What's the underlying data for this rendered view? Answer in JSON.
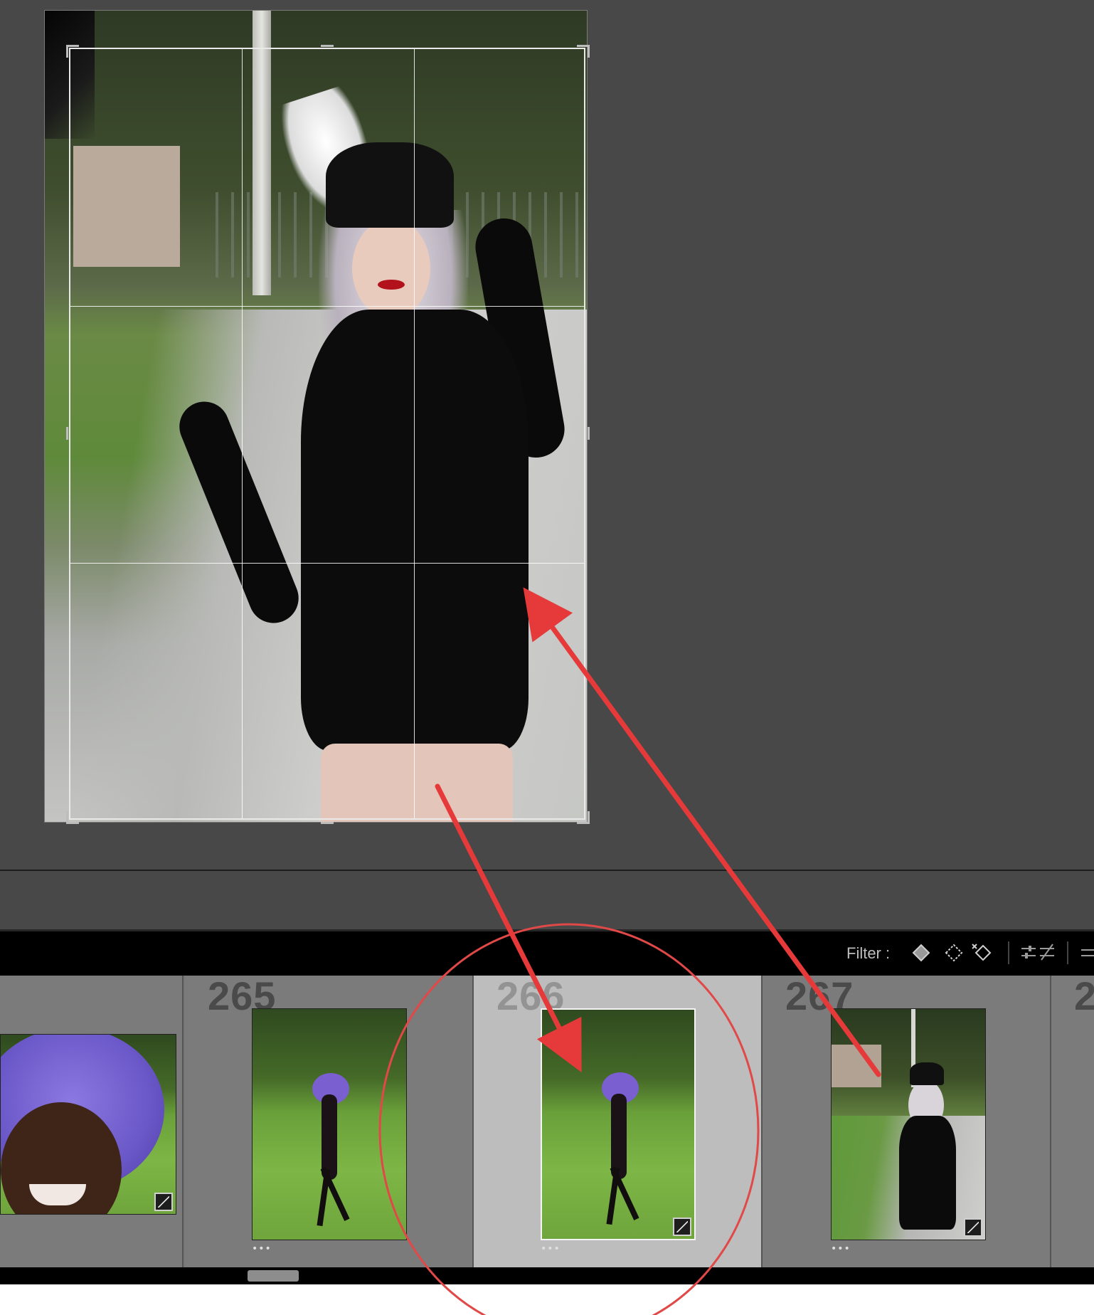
{
  "filmstrip": {
    "filter_label": "Filter :",
    "cells": [
      {
        "number": "",
        "dots": "",
        "has_badge": true
      },
      {
        "number": "265",
        "dots": "•••",
        "has_badge": false
      },
      {
        "number": "266",
        "dots": "•••",
        "has_badge": true,
        "selected": true
      },
      {
        "number": "267",
        "dots": "•••",
        "has_badge": true
      },
      {
        "number": "2",
        "dots": "",
        "has_badge": false
      }
    ]
  },
  "icons": {
    "filter_flags": [
      "flag-picked-icon",
      "flag-unflagged-icon",
      "flag-rejected-icon"
    ],
    "filter_extra": [
      "slider-filter-icon",
      "slider-filter-off-icon"
    ],
    "crop_handles": "crop-handle-icon",
    "adjustment_badge": "develop-adjusted-icon"
  },
  "colors": {
    "workspace": "#484848",
    "filmstrip": "#7b7b7b",
    "selected_cell": "#bdbdbd",
    "annotation": "#e63a3a"
  }
}
